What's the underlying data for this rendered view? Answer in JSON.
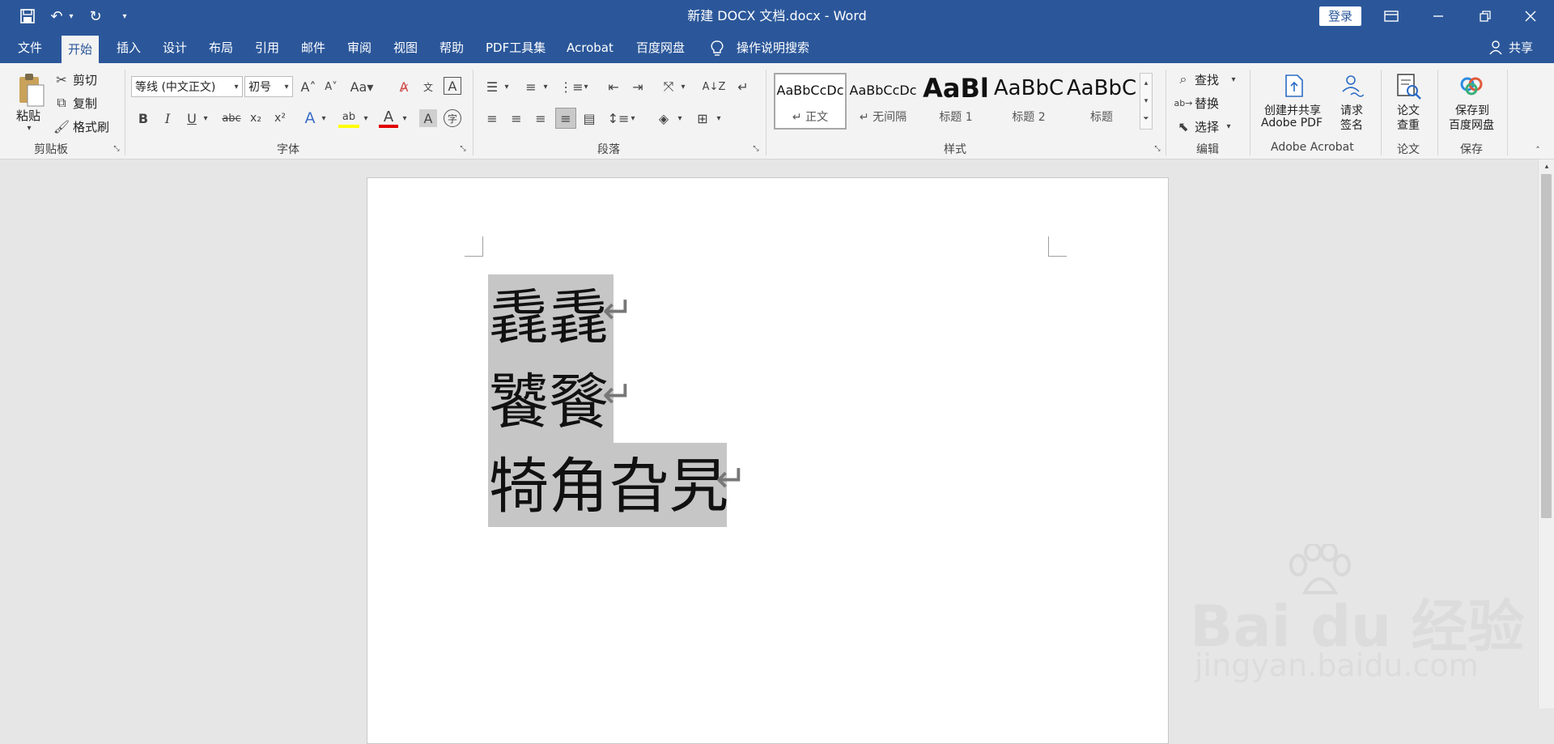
{
  "window": {
    "title": "新建 DOCX 文档.docx  -  Word",
    "login_label": "登录"
  },
  "tabs": [
    {
      "label": "文件"
    },
    {
      "label": "开始"
    },
    {
      "label": "插入"
    },
    {
      "label": "设计"
    },
    {
      "label": "布局"
    },
    {
      "label": "引用"
    },
    {
      "label": "邮件"
    },
    {
      "label": "审阅"
    },
    {
      "label": "视图"
    },
    {
      "label": "帮助"
    },
    {
      "label": "PDF工具集"
    },
    {
      "label": "Acrobat"
    },
    {
      "label": "百度网盘"
    }
  ],
  "tell_me": "操作说明搜索",
  "share_label": "共享",
  "clipboard": {
    "paste": "粘贴",
    "cut": "剪切",
    "copy": "复制",
    "format_painter": "格式刷",
    "group": "剪贴板"
  },
  "font": {
    "font_name": "等线 (中文正文)",
    "font_size": "初号",
    "group": "字体"
  },
  "paragraph": {
    "group": "段落"
  },
  "styles": {
    "group": "样式",
    "items": [
      {
        "sample": "AaBbCcDc",
        "name": "↵ 正文"
      },
      {
        "sample": "AaBbCcDc",
        "name": "↵ 无间隔"
      },
      {
        "sample": "AaBl",
        "name": "标题 1"
      },
      {
        "sample": "AaBbC",
        "name": "标题 2"
      },
      {
        "sample": "AaBbC",
        "name": "标题"
      }
    ]
  },
  "editing": {
    "find": "查找",
    "replace": "替换",
    "select": "选择",
    "group": "编辑"
  },
  "acrobat": {
    "create_line1": "创建并共享",
    "create_line2": "Adobe PDF",
    "sign_line1": "请求",
    "sign_line2": "签名",
    "group": "Adobe Acrobat"
  },
  "paper": {
    "label_line1": "论文",
    "label_line2": "查重",
    "group": "论文"
  },
  "save": {
    "label_line1": "保存到",
    "label_line2": "百度网盘",
    "group": "保存"
  },
  "document": {
    "lines": [
      "毳毳",
      "饕餮",
      "犄角旮旯"
    ]
  },
  "watermark": {
    "brand": "Bai du 经验",
    "url": "jingyan.baidu.com"
  }
}
